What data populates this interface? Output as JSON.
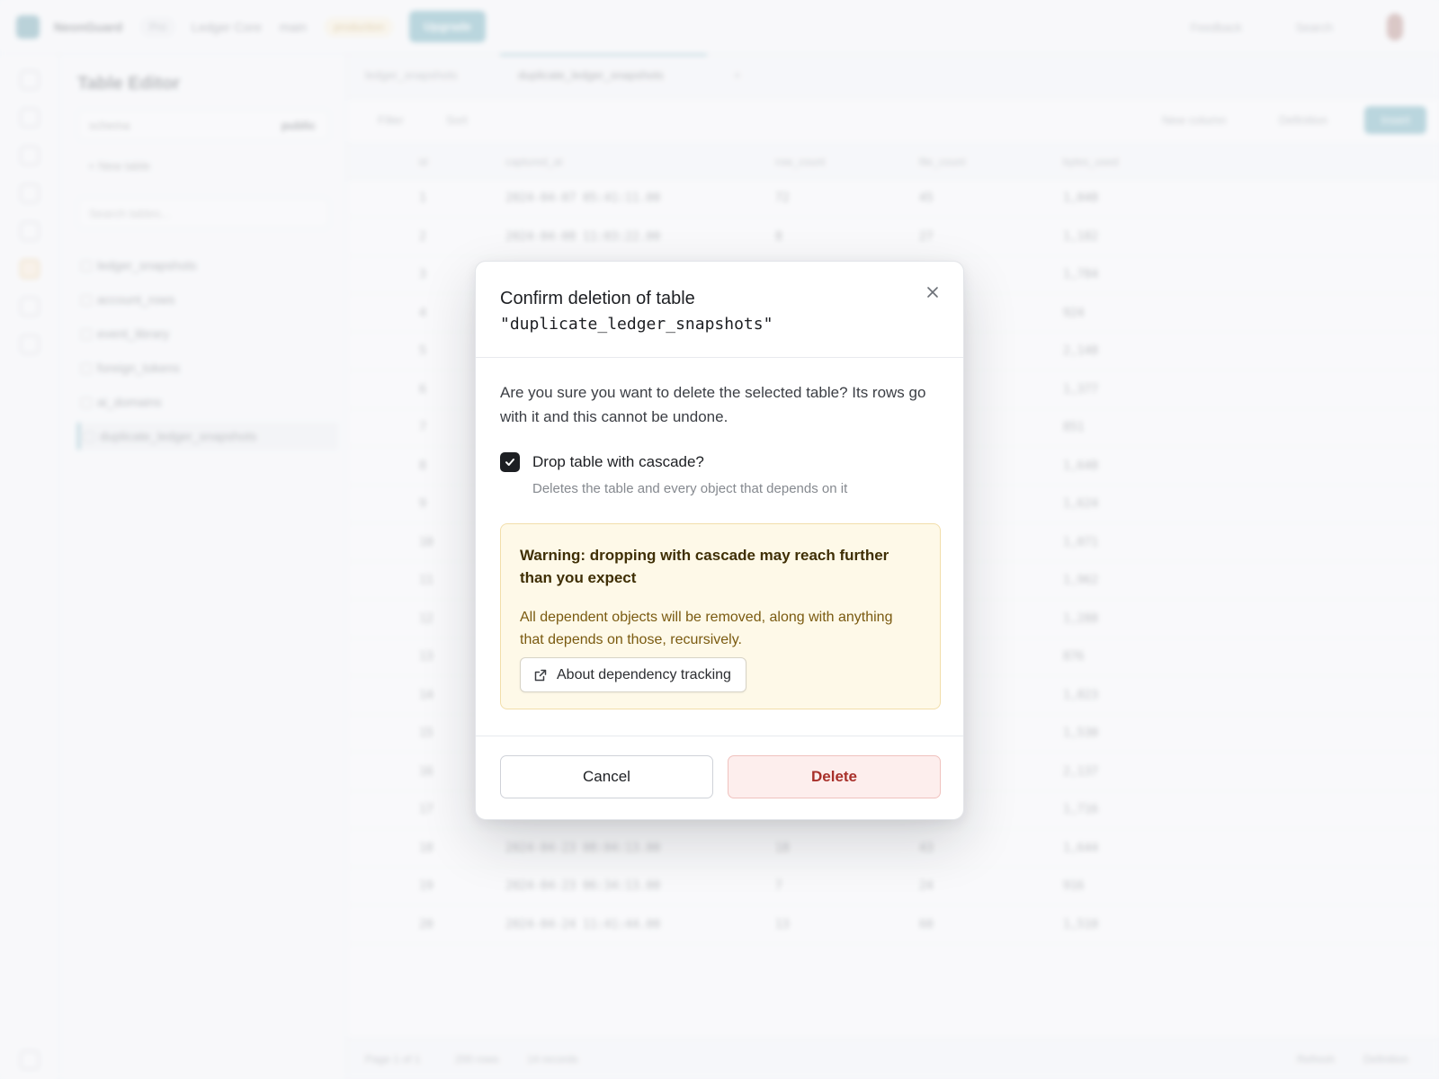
{
  "background": {
    "topbar": {
      "org": "NeonGuard",
      "plan": "Pro",
      "project": "Ledger Core",
      "branch": "main",
      "env_badge": "production",
      "upgrade_label": "Upgrade",
      "feedback_label": "Feedback",
      "search_label": "Search"
    },
    "sidebar": {
      "title": "Table Editor",
      "schema_label": "schema",
      "schema_value": "public",
      "new_table_label": "+ New table",
      "search_placeholder": "Search tables...",
      "tables": [
        "ledger_snapshots",
        "account_rows",
        "event_library",
        "foreign_tokens",
        "ai_domains",
        "duplicate_ledger_snapshots"
      ]
    },
    "tabs": [
      "ledger_snapshots",
      "duplicate_ledger_snapshots",
      "+"
    ],
    "toolbar": {
      "filter_label": "Filter",
      "sort_label": "Sort",
      "new_column_label": "New column",
      "definition_label": "Definition",
      "insert_label": "Insert"
    },
    "columns": [
      "id",
      "captured_at",
      "row_count",
      "file_count",
      "bytes_used"
    ],
    "rows": [
      [
        "1",
        "2024-04-07 05:41:11.00",
        "72",
        "45",
        "1,048"
      ],
      [
        "2",
        "2024-04-08 11:03:22.00",
        "8",
        "27",
        "1,182"
      ],
      [
        "3",
        "",
        "",
        "",
        "1,784"
      ],
      [
        "4",
        "",
        "",
        "",
        "924"
      ],
      [
        "5",
        "",
        "",
        "",
        "2,148"
      ],
      [
        "6",
        "",
        "",
        "",
        "1,377"
      ],
      [
        "7",
        "",
        "",
        "",
        "851"
      ],
      [
        "8",
        "",
        "",
        "",
        "1,648"
      ],
      [
        "9",
        "",
        "",
        "",
        "1,624"
      ],
      [
        "10",
        "",
        "",
        "",
        "1,071"
      ],
      [
        "11",
        "",
        "",
        "",
        "1,962"
      ],
      [
        "12",
        "",
        "",
        "",
        "1,288"
      ],
      [
        "13",
        "",
        "",
        "",
        "876"
      ],
      [
        "14",
        "",
        "",
        "",
        "1,823"
      ],
      [
        "15",
        "",
        "",
        "",
        "1,530"
      ],
      [
        "16",
        "",
        "",
        "",
        "2,137"
      ],
      [
        "17",
        "",
        "",
        "",
        "1,716"
      ],
      [
        "18",
        "2024-04-23 08:04:13.00",
        "18",
        "43",
        "1,644"
      ],
      [
        "19",
        "2024-04-23 06:34:13.00",
        "7",
        "24",
        "916"
      ],
      [
        "20",
        "2024-04-24 11:41:44.00",
        "13",
        "60",
        "1,510"
      ]
    ],
    "status": {
      "page_label": "Page 1 of 1",
      "records_label": "200 rows",
      "time_label": "14 records",
      "refresh_label": "Refresh",
      "settings_label": "Definition"
    }
  },
  "modal": {
    "title": "Confirm deletion of table",
    "table_name": "\"duplicate_ledger_snapshots\"",
    "body": "Are you sure you want to delete the selected table? Its rows go with it and this cannot be undone.",
    "cascade_label": "Drop table with cascade?",
    "cascade_checked": true,
    "cascade_hint": "Deletes the table and every object that depends on it",
    "warning_title": "Warning: dropping with cascade may reach further than you expect",
    "warning_text": "All dependent objects will be removed, along with anything that depends on those, recursively.",
    "link_label": "About dependency tracking",
    "cancel_label": "Cancel",
    "delete_label": "Delete"
  },
  "colors": {
    "accent": "#2f8a9e",
    "danger_text": "#a8302a",
    "danger_bg": "#fdeeed",
    "warning_bg": "#fef9e8"
  },
  "icons": {
    "close": "close-icon",
    "check": "check-icon",
    "link": "external-link-icon"
  }
}
